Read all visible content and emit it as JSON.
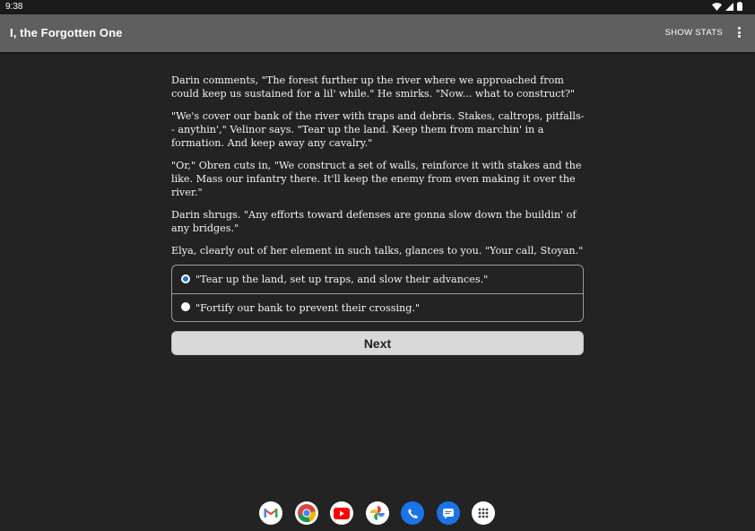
{
  "status_bar": {
    "time": "9:38"
  },
  "app_bar": {
    "title": "I, the Forgotten One",
    "show_stats_label": "SHOW STATS",
    "overflow_icon": "more-vert-icon"
  },
  "story": {
    "paragraphs": [
      "Darin comments, \"The forest further up the river where we approached from could keep us sustained for a lil' while.\" He smirks. \"Now... what to construct?\"",
      "\"We's cover our bank of the river with traps and debris. Stakes, caltrops, pitfalls-- anythin',\" Velinor says. \"Tear up the land. Keep them from marchin' in a formation. And keep away any cavalry.\"",
      "\"Or,\" Obren cuts in, \"We construct a set of walls, reinforce it with stakes and the like. Mass our infantry there. It'll keep the enemy from even making it over the river.\"",
      "Darin shrugs. \"Any efforts toward defenses are gonna slow down the buildin' of any bridges.\"",
      "Elya, clearly out of her element in such talks, glances to you. \"Your call, Stoyan.\""
    ]
  },
  "choices": [
    {
      "label": "\"Tear up the land, set up traps, and slow their advances.\"",
      "selected": true
    },
    {
      "label": "\"Fortify our bank to prevent their crossing.\"",
      "selected": false
    }
  ],
  "next_button": {
    "label": "Next"
  },
  "dock": {
    "apps": [
      "gmail-icon",
      "chrome-icon",
      "youtube-icon",
      "photos-icon",
      "phone-icon",
      "messages-icon",
      "app-drawer-icon"
    ]
  },
  "colors": {
    "background": "#232323",
    "app_bar": "#5f5f5f",
    "accent_radio": "#1e6fe0",
    "button_bg": "#d9d9d9"
  }
}
